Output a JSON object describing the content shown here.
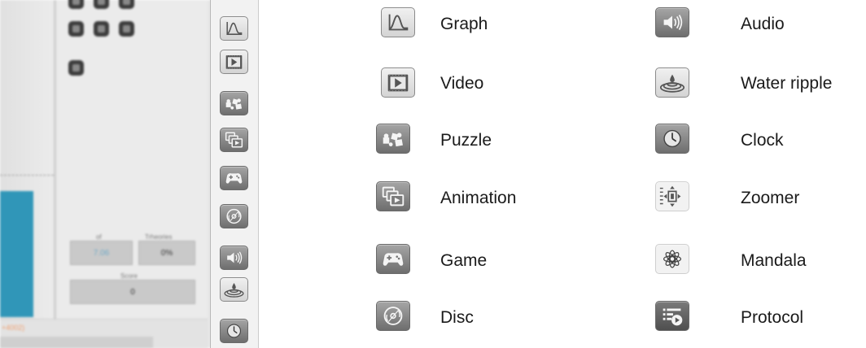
{
  "app_preview": {
    "stat_left_caption": "of",
    "stat_left_value": "7.06",
    "stat_right_caption": "Trheories",
    "stat_right_value": "0%",
    "score_caption": "Score",
    "score_value": "0",
    "bottom_label": "+4002)"
  },
  "toolbar": {
    "buttons": [
      {
        "icon": "graph-icon"
      },
      {
        "icon": "video-icon"
      },
      {
        "icon": "puzzle-icon"
      },
      {
        "icon": "animation-icon"
      },
      {
        "icon": "game-icon"
      },
      {
        "icon": "disc-icon"
      },
      {
        "icon": "audio-icon"
      },
      {
        "icon": "water-ripple-icon"
      },
      {
        "icon": "clock-icon"
      }
    ]
  },
  "legend": {
    "left": [
      {
        "icon": "graph-icon",
        "label": "Graph"
      },
      {
        "icon": "video-icon",
        "label": "Video"
      },
      {
        "icon": "puzzle-icon",
        "label": "Puzzle"
      },
      {
        "icon": "animation-icon",
        "label": "Animation"
      },
      {
        "icon": "game-icon",
        "label": "Game"
      },
      {
        "icon": "disc-icon",
        "label": "Disc"
      }
    ],
    "right": [
      {
        "icon": "audio-icon",
        "label": "Audio"
      },
      {
        "icon": "water-ripple-icon",
        "label": "Water ripple"
      },
      {
        "icon": "clock-icon",
        "label": "Clock"
      },
      {
        "icon": "zoomer-icon",
        "label": "Zoomer"
      },
      {
        "icon": "mandala-icon",
        "label": "Mandala"
      },
      {
        "icon": "protocol-icon",
        "label": "Protocol"
      }
    ]
  }
}
